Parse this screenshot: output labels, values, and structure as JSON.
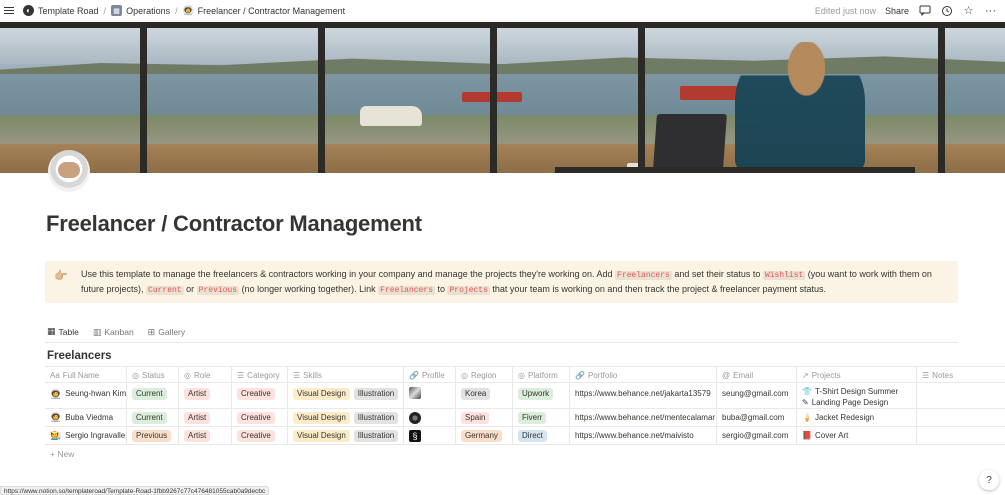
{
  "topbar": {
    "breadcrumbs": [
      {
        "label": "Template Road",
        "icon": "template-road-logo-icon"
      },
      {
        "label": "Operations",
        "icon": "office-building-icon"
      },
      {
        "label": "Freelancer / Contractor Management",
        "icon": "astronaut-icon"
      }
    ],
    "separator": "/",
    "edited": "Edited just now",
    "share": "Share"
  },
  "page": {
    "icon": "astronaut-emoji",
    "title": "Freelancer / Contractor Management"
  },
  "callout": {
    "icon": "👉🏼",
    "t1": "Use this template to manage the freelancers & contractors working in your company and manage the projects they're working on. Add ",
    "c1": "Freelancers",
    "t2": " and set their status to ",
    "c2": "Wishlist",
    "t3": " (you want to work with them on future projects), ",
    "c3": "Current",
    "t4": " or ",
    "c4": "Previous",
    "t5": " (no longer working together). Link ",
    "c5": "Freelancers",
    "t6": " to ",
    "c6": "Projects",
    "t7": " that your team is working on and then track the project & freelancer payment status."
  },
  "tabs": [
    {
      "label": "Table",
      "icon": "table-icon",
      "active": true
    },
    {
      "label": "Kanban",
      "icon": "kanban-icon",
      "active": false
    },
    {
      "label": "Gallery",
      "icon": "gallery-icon",
      "active": false
    }
  ],
  "database": {
    "title": "Freelancers",
    "columns": [
      {
        "label": "Full Name",
        "icon": "Aa"
      },
      {
        "label": "Status",
        "icon": "◎"
      },
      {
        "label": "Role",
        "icon": "◎"
      },
      {
        "label": "Category",
        "icon": "☰"
      },
      {
        "label": "Skills",
        "icon": "☰"
      },
      {
        "label": "Profile",
        "icon": "🔗"
      },
      {
        "label": "Region",
        "icon": "◎"
      },
      {
        "label": "Platform",
        "icon": "◎"
      },
      {
        "label": "Portfolio",
        "icon": "🔗"
      },
      {
        "label": "Email",
        "icon": "@"
      },
      {
        "label": "Projects",
        "icon": "↗"
      },
      {
        "label": "Notes",
        "icon": "☰"
      }
    ],
    "rows": [
      {
        "name": "Seung-hwan Kim",
        "status": "Current",
        "role": "Artist",
        "category": "Creative",
        "skills": [
          "Visual Design",
          "Illustration"
        ],
        "region": "Korea",
        "platform": "Upwork",
        "portfolio": "https://www.behance.net/jakarta13579",
        "email": "seung@gmail.com",
        "projects": [
          {
            "icon": "👕",
            "label": "T-Shirt Design Summer"
          },
          {
            "icon": "✎",
            "label": "Landing Page Design"
          }
        ]
      },
      {
        "name": "Buba Viedma",
        "status": "Current",
        "role": "Artist",
        "category": "Creative",
        "skills": [
          "Visual Design",
          "Illustration"
        ],
        "region": "Spain",
        "platform": "Fiverr",
        "portfolio": "https://www.behance.net/mentecalamar",
        "email": "buba@gmail.com",
        "projects": [
          {
            "icon": "🍦",
            "label": "Jacket Redesign"
          }
        ]
      },
      {
        "name": "Sergio Ingravalle",
        "status": "Previous",
        "role": "Artist",
        "category": "Creative",
        "skills": [
          "Visual Design",
          "Illustration"
        ],
        "region": "Germany",
        "platform": "Direct",
        "portfolio": "https://www.behance.net/maivisto",
        "email": "sergio@gmail.com",
        "projects": [
          {
            "icon": "📕",
            "label": "Cover Art"
          }
        ]
      }
    ],
    "new_label": "+ New"
  },
  "statusbar": {
    "url": "https://www.notion.so/templateroad/Template-Road-1fbb9267c77c476481055cab0a9decbc"
  },
  "help": "?",
  "colors": {
    "callout_bg": "#fbf3e3",
    "code_text": "#eb5757",
    "status_current_bg": "#dbeddb",
    "status_previous_bg": "#fadec9",
    "role_bg": "#ffe2dd",
    "category_bg": "#ffe2dd",
    "skill_visual_bg": "#fdecc8",
    "skill_illustration_bg": "#e3e2e0",
    "region_bg": "#e3e2e0",
    "platform_upwork_bg": "#dbeddb",
    "platform_fiverr_bg": "#dbeddb",
    "platform_direct_bg": "#d3e5ef"
  }
}
